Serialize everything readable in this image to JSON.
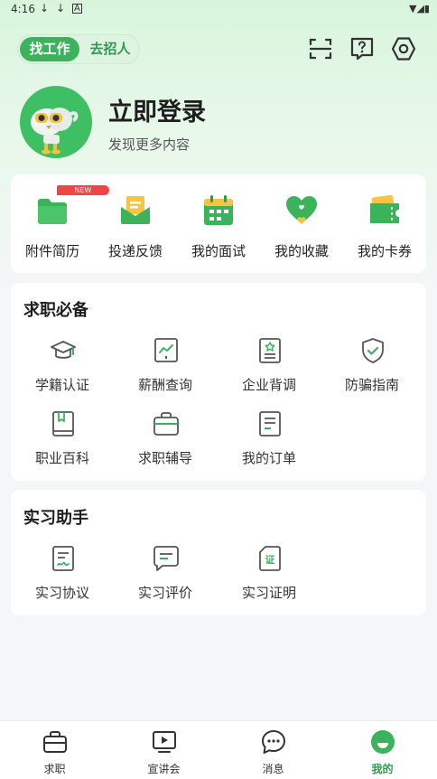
{
  "status_bar": {
    "time": "4:16",
    "download_icon_1": "↓",
    "download_icon_2": "↓",
    "a_icon": "A",
    "right_icons": "▼◢▮"
  },
  "header": {
    "toggle_active": "找工作",
    "toggle_inactive": "去招人",
    "icons": [
      "scan-icon",
      "help-icon",
      "settings-icon"
    ]
  },
  "profile": {
    "title": "立即登录",
    "subtitle": "发现更多内容"
  },
  "quick_actions": [
    {
      "label": "附件简历",
      "icon": "folder-icon",
      "badge": "NEW"
    },
    {
      "label": "投递反馈",
      "icon": "envelope-icon"
    },
    {
      "label": "我的面试",
      "icon": "calendar-icon"
    },
    {
      "label": "我的收藏",
      "icon": "heart-icon"
    },
    {
      "label": "我的卡券",
      "icon": "ticket-icon"
    }
  ],
  "job_section": {
    "title": "求职必备",
    "items": [
      {
        "label": "学籍认证",
        "icon": "graduation-cap-icon"
      },
      {
        "label": "薪酬查询",
        "icon": "salary-chart-icon"
      },
      {
        "label": "企业背调",
        "icon": "company-check-icon"
      },
      {
        "label": "防骗指南",
        "icon": "shield-check-icon"
      },
      {
        "label": "职业百科",
        "icon": "book-icon"
      },
      {
        "label": "求职辅导",
        "icon": "briefcase-icon"
      },
      {
        "label": "我的订单",
        "icon": "order-list-icon"
      }
    ]
  },
  "intern_section": {
    "title": "实习助手",
    "items": [
      {
        "label": "实习协议",
        "icon": "agreement-icon"
      },
      {
        "label": "实习评价",
        "icon": "comment-icon"
      },
      {
        "label": "实习证明",
        "icon": "certificate-icon",
        "icon_text": "证"
      }
    ]
  },
  "tabbar": [
    {
      "label": "求职",
      "icon": "briefcase-tab-icon",
      "active": false
    },
    {
      "label": "宣讲会",
      "icon": "play-tab-icon",
      "active": false
    },
    {
      "label": "消息",
      "icon": "message-tab-icon",
      "active": false
    },
    {
      "label": "我的",
      "icon": "profile-tab-icon",
      "active": true
    }
  ],
  "colors": {
    "accent": "#3bb35b",
    "accent_dark": "#2e9b4e",
    "badge": "#f04545"
  }
}
